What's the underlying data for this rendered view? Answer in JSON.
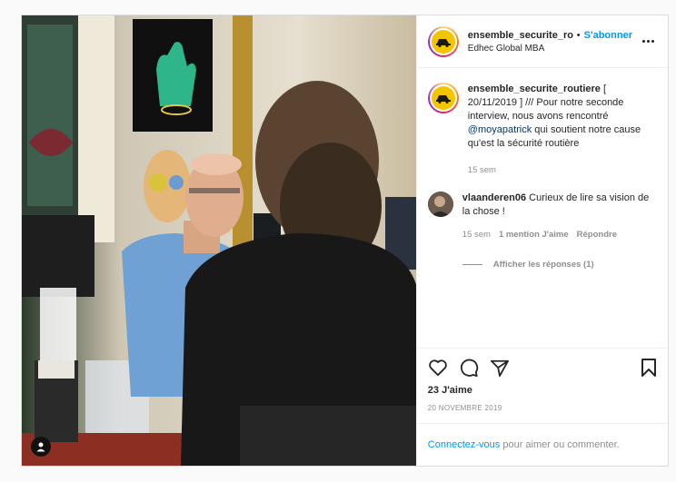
{
  "post": {
    "author": "ensemble_securite_rou",
    "separator": "•",
    "follow_label": "S'abonner",
    "location": "Edhec Global MBA",
    "more_label": "more-options"
  },
  "comments": [
    {
      "user": "ensemble_securite_routiere",
      "text_before": " [ 20/11/2019 ] /// Pour notre seconde interview, nous avons rencontré ",
      "mention": "@moyapatrick",
      "text_after": " qui soutient notre cause qu'est la sécurité routière",
      "time": "15 sem"
    },
    {
      "user": "vlaanderen06",
      "text": " Curieux de lire sa vision de la chose !",
      "time": "15 sem",
      "likes": "1 mention J'aime",
      "reply": "Répondre",
      "show_replies": "Afficher les réponses (1)"
    }
  ],
  "actions": {
    "likes": "23 J'aime",
    "date": "20 NOVEMBRE 2019"
  },
  "footer": {
    "login_link": "Connectez-vous",
    "login_text": " pour aimer ou commenter."
  },
  "colors": {
    "accent": "#0095f6",
    "mention": "#00376b",
    "muted": "#8e8e8e"
  }
}
